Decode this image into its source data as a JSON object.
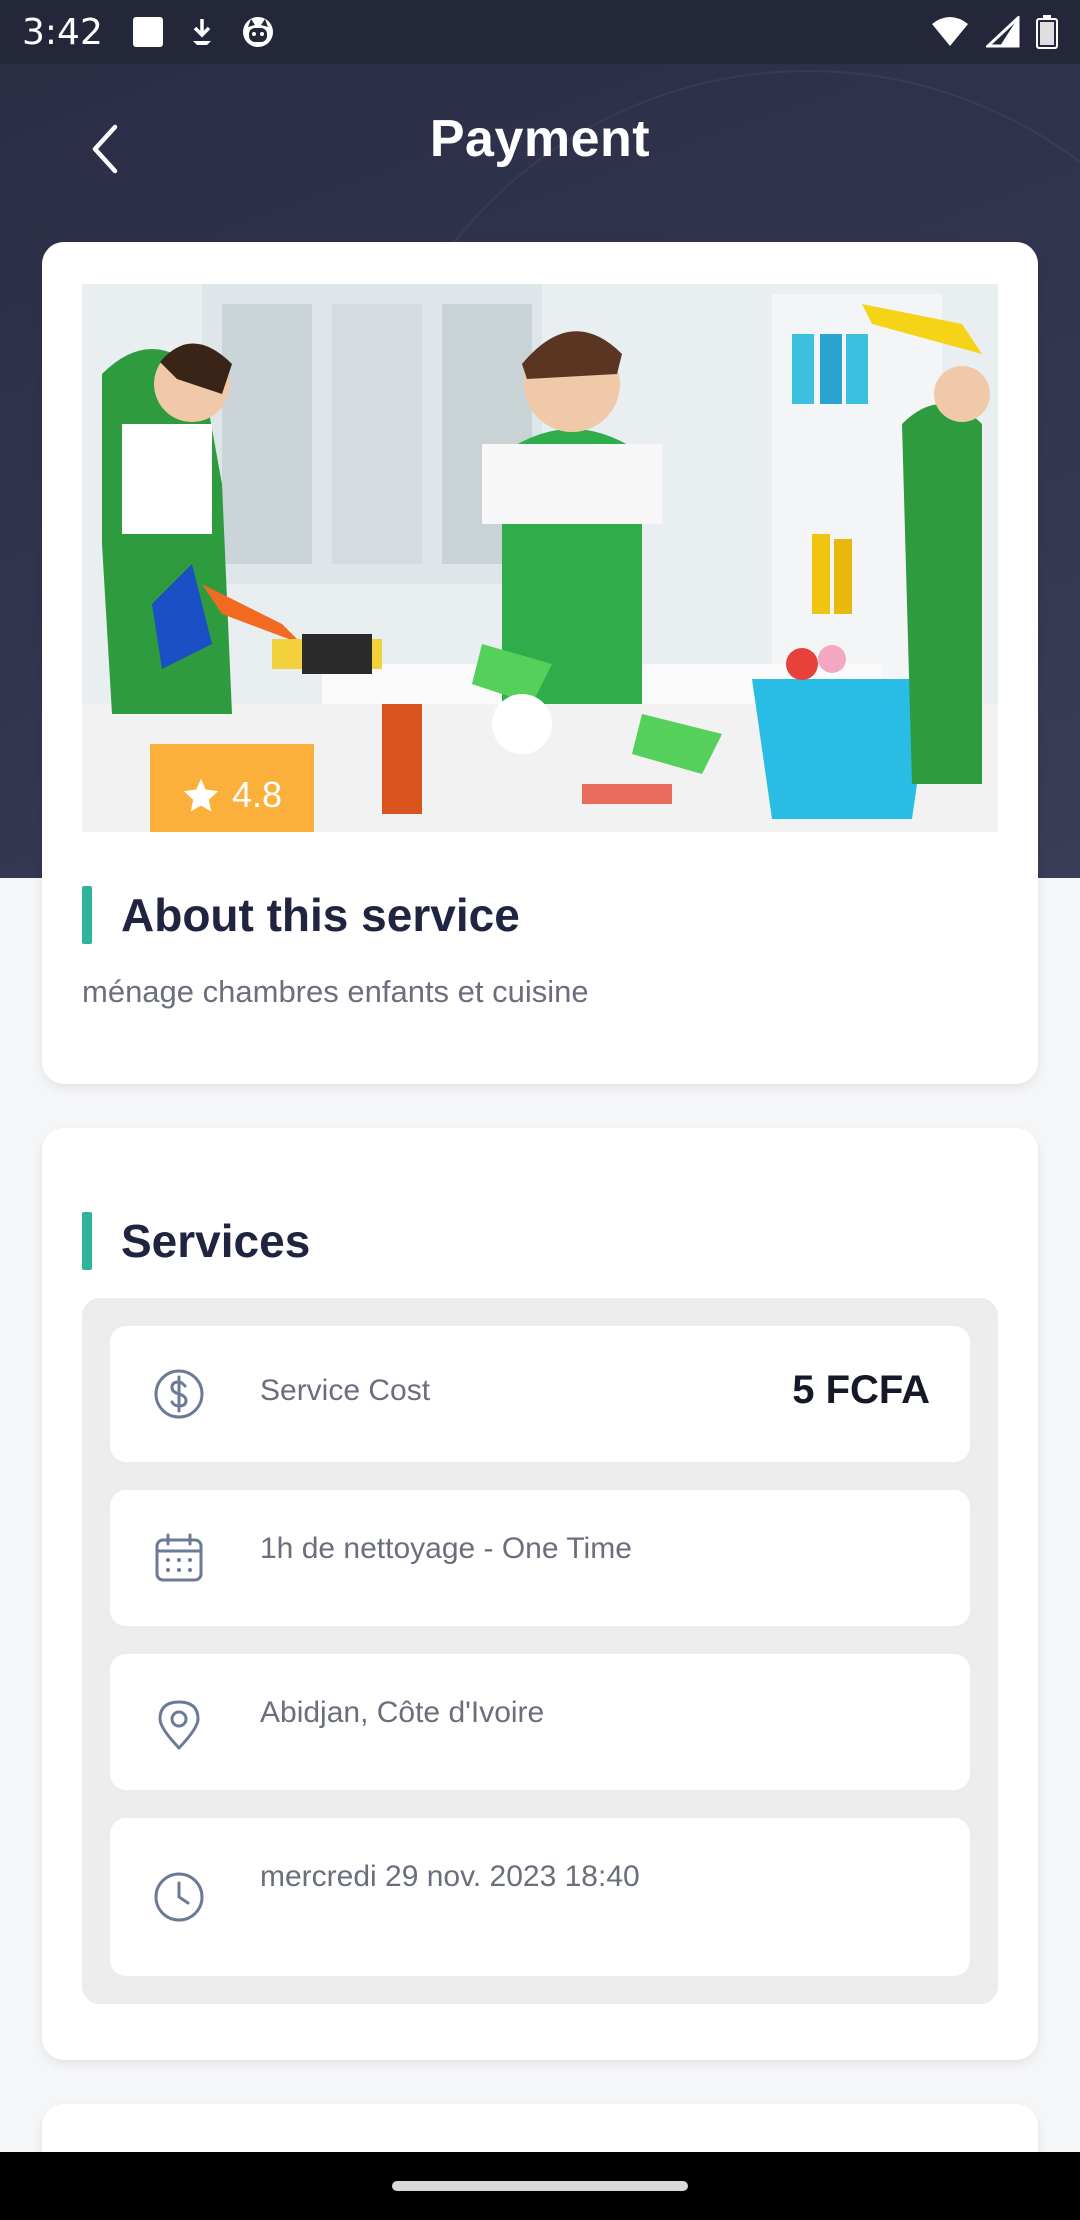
{
  "status_bar": {
    "time": "3:42",
    "icons_left": [
      "square-notification-icon",
      "download-icon",
      "cat-face-icon"
    ],
    "icons_right": [
      "wifi-icon",
      "signal-icon",
      "battery-icon"
    ]
  },
  "header": {
    "title": "Payment",
    "back_icon": "chevron-left-icon"
  },
  "about_card": {
    "image_description": "cleaning-staff-photo",
    "rating": "4.8",
    "title": "About this service",
    "description": "ménage chambres enfants et cuisine"
  },
  "services_card": {
    "title": "Services",
    "rows": [
      {
        "icon": "dollar-circle-icon",
        "label": "Service Cost",
        "value": "5 FCFA"
      },
      {
        "icon": "calendar-icon",
        "label": "1h de nettoyage - One Time"
      },
      {
        "icon": "location-pin-icon",
        "label": "Abidjan, Côte d'Ivoire"
      },
      {
        "icon": "clock-icon",
        "label": "mercredi 29 nov. 2023 18:40"
      }
    ]
  },
  "colors": {
    "header_bg": "#2b2d45",
    "accent": "#2fb39a",
    "rating_badge": "#fbb03b",
    "title_text": "#1f2540",
    "secondary_text": "#6b6f7d"
  }
}
